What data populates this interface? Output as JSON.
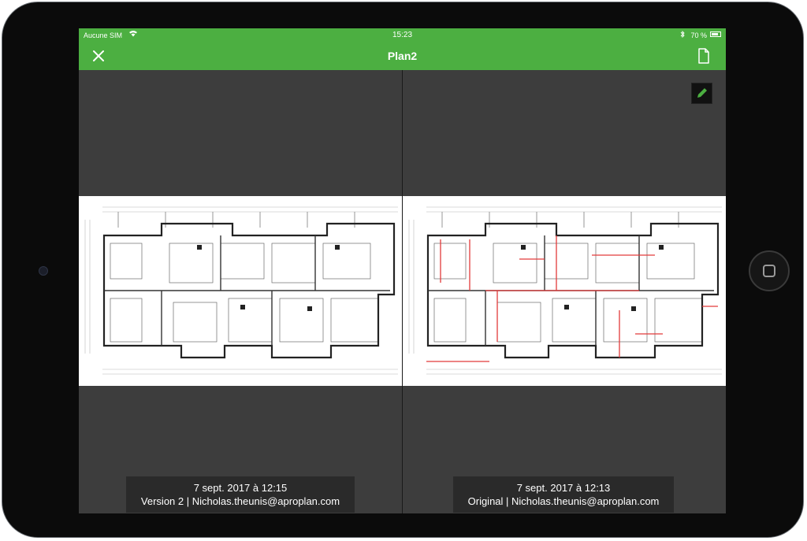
{
  "status_bar": {
    "carrier": "Aucune SIM",
    "time": "15:23",
    "battery_percent": "70 %"
  },
  "nav": {
    "title": "Plan2",
    "close_icon": "close-icon",
    "document_icon": "document-icon"
  },
  "left_pane": {
    "date": "7 sept. 2017 à 12:15",
    "info": "Version 2 | Nicholas.theunis@aproplan.com"
  },
  "right_pane": {
    "date": "7 sept. 2017 à 12:13",
    "info": "Original | Nicholas.theunis@aproplan.com",
    "edit_icon": "pencil-icon"
  },
  "colors": {
    "accent": "#4caf41",
    "background": "#3d3d3d",
    "annotation": "#e23a3a"
  }
}
